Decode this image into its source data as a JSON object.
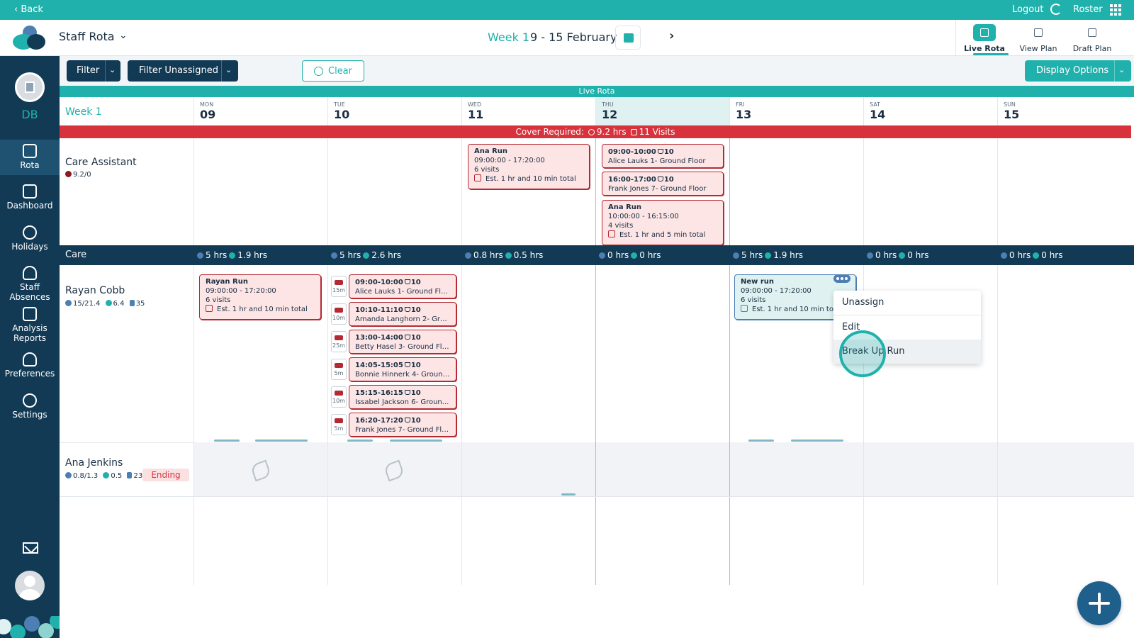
{
  "topbar": {
    "back": "‹ Back",
    "logout": "Logout",
    "roster": "Roster"
  },
  "header": {
    "app_title": "Staff Rota",
    "week_label": "Week 1",
    "date_range": "9 - 15 February",
    "view_tabs": [
      {
        "label": "Live Rota",
        "active": true
      },
      {
        "label": "View Plan",
        "active": false
      },
      {
        "label": "Draft Plan",
        "active": false
      }
    ]
  },
  "sidebar": {
    "initials": "DB",
    "items": [
      {
        "label": "Rota",
        "icon": "calendar-check-icon",
        "active": true
      },
      {
        "label": "Dashboard",
        "icon": "dashboard-icon"
      },
      {
        "label": "Holidays",
        "icon": "palm-tree-icon"
      },
      {
        "label": "Staff Absences",
        "icon": "staff-absences-icon"
      },
      {
        "label": "Analysis Reports",
        "icon": "analysis-report-icon"
      },
      {
        "label": "Preferences",
        "icon": "preferences-icon"
      },
      {
        "label": "Settings",
        "icon": "gear-icon"
      }
    ]
  },
  "toolbar": {
    "filter": "Filter",
    "filter_unassigned": "Filter Unassigned",
    "clear": "Clear",
    "display_options": "Display Options"
  },
  "banner": "Live Rota",
  "grid": {
    "week_head": "Week 1",
    "days": [
      {
        "dow": "MON",
        "date": "09"
      },
      {
        "dow": "TUE",
        "date": "10"
      },
      {
        "dow": "WED",
        "date": "11"
      },
      {
        "dow": "THU",
        "date": "12",
        "today": true
      },
      {
        "dow": "FRI",
        "date": "13"
      },
      {
        "dow": "SAT",
        "date": "14"
      },
      {
        "dow": "SUN",
        "date": "15"
      }
    ],
    "cover": {
      "label": "Cover Required:",
      "hours": "9.2 hrs",
      "visits": "11 Visits"
    }
  },
  "care_assistant": {
    "name": "Care Assistant",
    "stat": "9.2/0",
    "wed_run": {
      "title": "Ana Run",
      "time": "09:00:00 - 17:20:00",
      "visits": "6 visits",
      "est": "Est. 1 hr and 10 min total"
    },
    "thu_visit1": {
      "time": "09:00-10:00",
      "count": "10",
      "client": "Alice Lauks 1- Ground Floor"
    },
    "thu_visit2": {
      "time": "16:00-17:00",
      "count": "10",
      "client": "Frank Jones 7- Ground Floor"
    },
    "thu_run": {
      "title": "Ana Run",
      "time": "10:00:00 - 16:15:00",
      "visits": "4 visits",
      "est": "Est. 1 hr and 5 min total"
    }
  },
  "care_group": {
    "name": "Care",
    "cells": [
      {
        "a": "5 hrs",
        "b": "1.9 hrs"
      },
      {
        "a": "5 hrs",
        "b": "2.6 hrs"
      },
      {
        "a": "0.8 hrs",
        "b": "0.5 hrs"
      },
      {
        "a": "0 hrs",
        "b": "0 hrs"
      },
      {
        "a": "5 hrs",
        "b": "1.9 hrs"
      },
      {
        "a": "0 hrs",
        "b": "0 hrs"
      },
      {
        "a": "0 hrs",
        "b": "0 hrs"
      }
    ]
  },
  "rayan": {
    "name": "Rayan Cobb",
    "hours": "15/21.4",
    "extra": "6.4",
    "visits": "35",
    "mon_run": {
      "title": "Rayan Run",
      "time": "09:00:00 - 17:20:00",
      "visits": "6 visits",
      "est": "Est. 1 hr and 10 min total"
    },
    "tue_visits": [
      {
        "travel": "15m",
        "time": "09:00-10:00",
        "count": "10",
        "client": "Alice Lauks 1- Ground Floor"
      },
      {
        "travel": "10m",
        "time": "10:10-11:10",
        "count": "10",
        "client": "Amanda Langhorn 2- Gro..."
      },
      {
        "travel": "25m",
        "time": "13:00-14:00",
        "count": "10",
        "client": "Betty Hasel 3- Ground Floor"
      },
      {
        "travel": "5m",
        "time": "14:05-15:05",
        "count": "10",
        "client": "Bonnie Hinnerk 4- Ground ..."
      },
      {
        "travel": "10m",
        "time": "15:15-16:15",
        "count": "10",
        "client": "Issabel Jackson 6- Groun..."
      },
      {
        "travel": "5m",
        "time": "16:20-17:20",
        "count": "10",
        "client": "Frank Jones 7- Ground Flo..."
      }
    ],
    "fri_run": {
      "title": "New run",
      "time": "09:00:00 - 17:20:00",
      "visits": "6 visits",
      "est": "Est. 1 hr and 10 min tota"
    }
  },
  "context_menu": [
    "Unassign",
    "Edit",
    "Break Up Run"
  ],
  "ana": {
    "name": "Ana Jenkins",
    "hours": "0.8/1.3",
    "extra": "0.5",
    "visits": "23",
    "status": "Ending"
  }
}
